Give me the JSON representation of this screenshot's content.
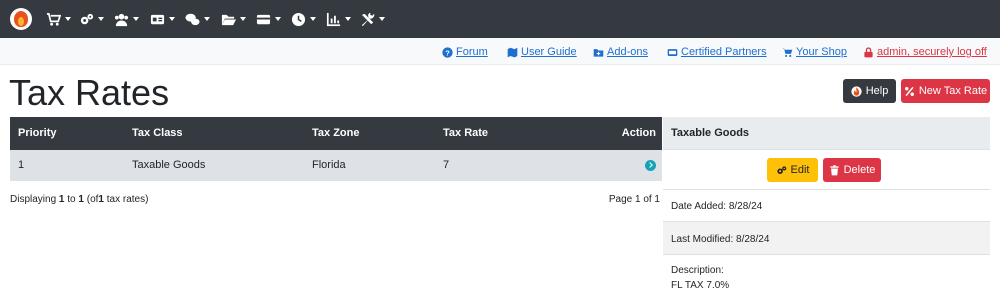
{
  "nav": {
    "menus": [
      "catalog-menu",
      "configuration-menu",
      "customers-menu",
      "modules-menu",
      "extras-menu",
      "tools-menu",
      "payments-menu",
      "timer-menu",
      "reports-menu",
      "admin-tools-menu"
    ]
  },
  "links_bar": {
    "forum": "Forum",
    "user_guide": "User Guide",
    "addons": "Add-ons",
    "certified_partners": "Certified Partners",
    "your_shop": "Your Shop",
    "logoff": "admin, securely log off"
  },
  "page": {
    "title": "Tax Rates",
    "help_button": "Help",
    "new_button": "New Tax Rate"
  },
  "table": {
    "columns": [
      "Priority",
      "Tax Class",
      "Tax Zone",
      "Tax Rate",
      "Action"
    ],
    "rows": [
      {
        "priority": "1",
        "tax_class": "Taxable Goods",
        "tax_zone": "Florida",
        "tax_rate": "7"
      }
    ],
    "pagination": {
      "displaying_prefix": "Displaying",
      "from": "1",
      "to_word": "to",
      "to": "1",
      "of_prefix": "(of",
      "total": "1",
      "of_suffix": "tax rates)",
      "page_info": "Page 1 of 1"
    }
  },
  "side_panel": {
    "heading": "Taxable Goods",
    "edit_button": "Edit",
    "delete_button": "Delete",
    "date_added": "Date Added: 8/28/24",
    "last_modified": "Last Modified: 8/28/24",
    "description_label": "Description:",
    "description_value": "FL TAX 7.0%"
  },
  "colors": {
    "navbar": "#343a40",
    "link": "#1f6fd1",
    "danger": "#dc3545",
    "warning": "#ffc107",
    "info": "#17a2b8"
  }
}
